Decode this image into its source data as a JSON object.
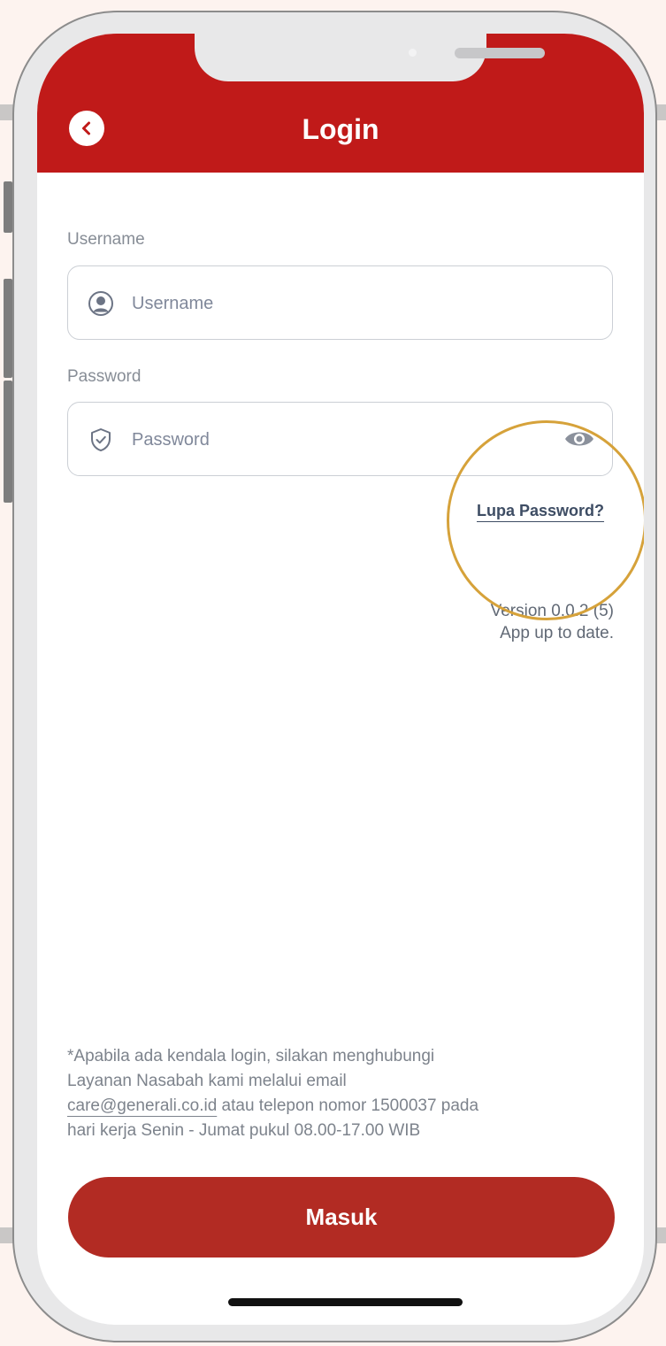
{
  "header": {
    "title": "Login",
    "back_icon": "chevron-left-icon",
    "color": "#c01a19"
  },
  "form": {
    "username_label": "Username",
    "username_placeholder": "Username",
    "username_value": "",
    "username_icon": "user-circle-icon",
    "password_label": "Password",
    "password_placeholder": "Password",
    "password_value": "",
    "password_icon": "shield-check-icon",
    "visibility_icon": "eye-icon",
    "forgot_password": "Lupa Password?"
  },
  "version": {
    "line1": "Version 0.0.2 (5)",
    "line2": "App up to date."
  },
  "note": {
    "line1": "*Apabila ada kendala login, silakan menghubungi",
    "line2": "Layanan Nasabah kami melalui email",
    "email": "care@generali.co.id",
    "line3_rest": " atau telepon nomor 1500037 pada",
    "line4": "hari kerja Senin - Jumat pukul 08.00-17.00 WIB"
  },
  "submit": {
    "label": "Masuk",
    "color": "#b22b23"
  },
  "highlight_color": "#d6a23a"
}
